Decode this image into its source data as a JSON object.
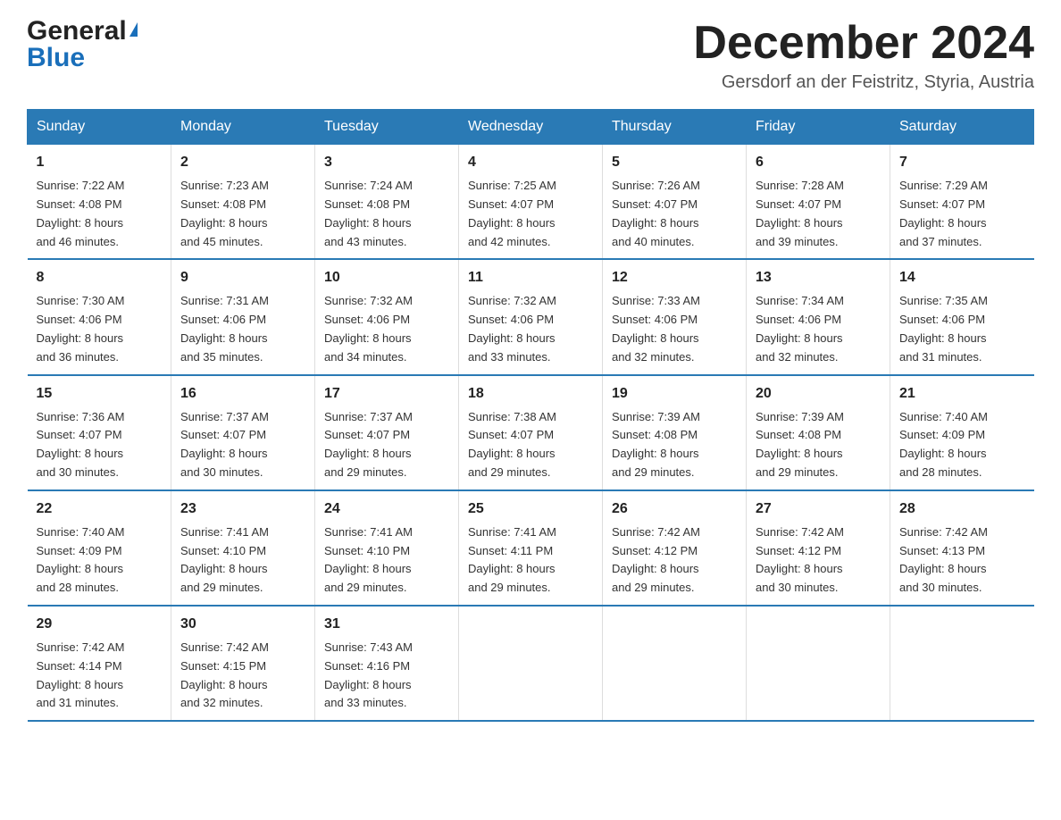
{
  "header": {
    "logo_line1": "General",
    "logo_line2": "Blue",
    "month_title": "December 2024",
    "location": "Gersdorf an der Feistritz, Styria, Austria"
  },
  "days_of_week": [
    "Sunday",
    "Monday",
    "Tuesday",
    "Wednesday",
    "Thursday",
    "Friday",
    "Saturday"
  ],
  "weeks": [
    [
      {
        "num": "1",
        "sunrise": "7:22 AM",
        "sunset": "4:08 PM",
        "daylight": "8 hours and 46 minutes."
      },
      {
        "num": "2",
        "sunrise": "7:23 AM",
        "sunset": "4:08 PM",
        "daylight": "8 hours and 45 minutes."
      },
      {
        "num": "3",
        "sunrise": "7:24 AM",
        "sunset": "4:08 PM",
        "daylight": "8 hours and 43 minutes."
      },
      {
        "num": "4",
        "sunrise": "7:25 AM",
        "sunset": "4:07 PM",
        "daylight": "8 hours and 42 minutes."
      },
      {
        "num": "5",
        "sunrise": "7:26 AM",
        "sunset": "4:07 PM",
        "daylight": "8 hours and 40 minutes."
      },
      {
        "num": "6",
        "sunrise": "7:28 AM",
        "sunset": "4:07 PM",
        "daylight": "8 hours and 39 minutes."
      },
      {
        "num": "7",
        "sunrise": "7:29 AM",
        "sunset": "4:07 PM",
        "daylight": "8 hours and 37 minutes."
      }
    ],
    [
      {
        "num": "8",
        "sunrise": "7:30 AM",
        "sunset": "4:06 PM",
        "daylight": "8 hours and 36 minutes."
      },
      {
        "num": "9",
        "sunrise": "7:31 AM",
        "sunset": "4:06 PM",
        "daylight": "8 hours and 35 minutes."
      },
      {
        "num": "10",
        "sunrise": "7:32 AM",
        "sunset": "4:06 PM",
        "daylight": "8 hours and 34 minutes."
      },
      {
        "num": "11",
        "sunrise": "7:32 AM",
        "sunset": "4:06 PM",
        "daylight": "8 hours and 33 minutes."
      },
      {
        "num": "12",
        "sunrise": "7:33 AM",
        "sunset": "4:06 PM",
        "daylight": "8 hours and 32 minutes."
      },
      {
        "num": "13",
        "sunrise": "7:34 AM",
        "sunset": "4:06 PM",
        "daylight": "8 hours and 32 minutes."
      },
      {
        "num": "14",
        "sunrise": "7:35 AM",
        "sunset": "4:06 PM",
        "daylight": "8 hours and 31 minutes."
      }
    ],
    [
      {
        "num": "15",
        "sunrise": "7:36 AM",
        "sunset": "4:07 PM",
        "daylight": "8 hours and 30 minutes."
      },
      {
        "num": "16",
        "sunrise": "7:37 AM",
        "sunset": "4:07 PM",
        "daylight": "8 hours and 30 minutes."
      },
      {
        "num": "17",
        "sunrise": "7:37 AM",
        "sunset": "4:07 PM",
        "daylight": "8 hours and 29 minutes."
      },
      {
        "num": "18",
        "sunrise": "7:38 AM",
        "sunset": "4:07 PM",
        "daylight": "8 hours and 29 minutes."
      },
      {
        "num": "19",
        "sunrise": "7:39 AM",
        "sunset": "4:08 PM",
        "daylight": "8 hours and 29 minutes."
      },
      {
        "num": "20",
        "sunrise": "7:39 AM",
        "sunset": "4:08 PM",
        "daylight": "8 hours and 29 minutes."
      },
      {
        "num": "21",
        "sunrise": "7:40 AM",
        "sunset": "4:09 PM",
        "daylight": "8 hours and 28 minutes."
      }
    ],
    [
      {
        "num": "22",
        "sunrise": "7:40 AM",
        "sunset": "4:09 PM",
        "daylight": "8 hours and 28 minutes."
      },
      {
        "num": "23",
        "sunrise": "7:41 AM",
        "sunset": "4:10 PM",
        "daylight": "8 hours and 29 minutes."
      },
      {
        "num": "24",
        "sunrise": "7:41 AM",
        "sunset": "4:10 PM",
        "daylight": "8 hours and 29 minutes."
      },
      {
        "num": "25",
        "sunrise": "7:41 AM",
        "sunset": "4:11 PM",
        "daylight": "8 hours and 29 minutes."
      },
      {
        "num": "26",
        "sunrise": "7:42 AM",
        "sunset": "4:12 PM",
        "daylight": "8 hours and 29 minutes."
      },
      {
        "num": "27",
        "sunrise": "7:42 AM",
        "sunset": "4:12 PM",
        "daylight": "8 hours and 30 minutes."
      },
      {
        "num": "28",
        "sunrise": "7:42 AM",
        "sunset": "4:13 PM",
        "daylight": "8 hours and 30 minutes."
      }
    ],
    [
      {
        "num": "29",
        "sunrise": "7:42 AM",
        "sunset": "4:14 PM",
        "daylight": "8 hours and 31 minutes."
      },
      {
        "num": "30",
        "sunrise": "7:42 AM",
        "sunset": "4:15 PM",
        "daylight": "8 hours and 32 minutes."
      },
      {
        "num": "31",
        "sunrise": "7:43 AM",
        "sunset": "4:16 PM",
        "daylight": "8 hours and 33 minutes."
      },
      null,
      null,
      null,
      null
    ]
  ],
  "labels": {
    "sunrise": "Sunrise:",
    "sunset": "Sunset:",
    "daylight": "Daylight:"
  }
}
